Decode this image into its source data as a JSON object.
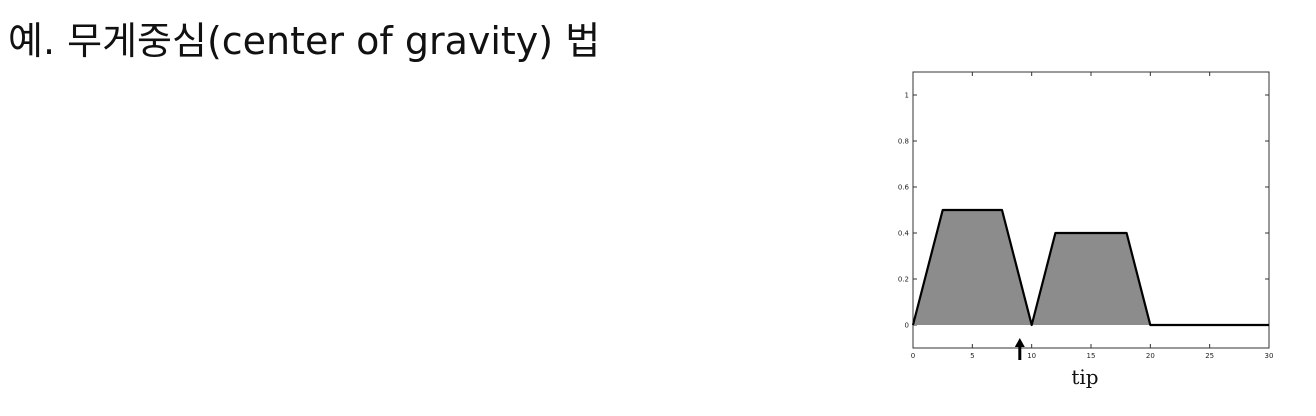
{
  "page": {
    "top_cutoff_text": "",
    "heading": "예. 무게중심(center of gravity) 법"
  },
  "chart_data": {
    "type": "area",
    "title": "",
    "xlabel": "tip",
    "ylabel": "",
    "xlim": [
      0,
      30
    ],
    "ylim": [
      -0.1,
      1.1
    ],
    "x_ticks": [
      0,
      5,
      10,
      15,
      20,
      25,
      30
    ],
    "y_ticks": [
      0,
      0.2,
      0.4,
      0.6,
      0.8,
      1
    ],
    "y_tick_labels": [
      "0",
      "0.2",
      "0.4",
      "0.6",
      "0.8",
      "1"
    ],
    "grid": false,
    "fill_color": "#8c8c8c",
    "series": [
      {
        "x": [
          0,
          2.5,
          7.5,
          10,
          12,
          18,
          20,
          30
        ],
        "y": [
          0,
          0.5,
          0.5,
          0,
          0.4,
          0.4,
          0,
          0
        ]
      }
    ],
    "annotations": [
      {
        "type": "arrow",
        "x": 9,
        "direction": "up"
      }
    ]
  }
}
